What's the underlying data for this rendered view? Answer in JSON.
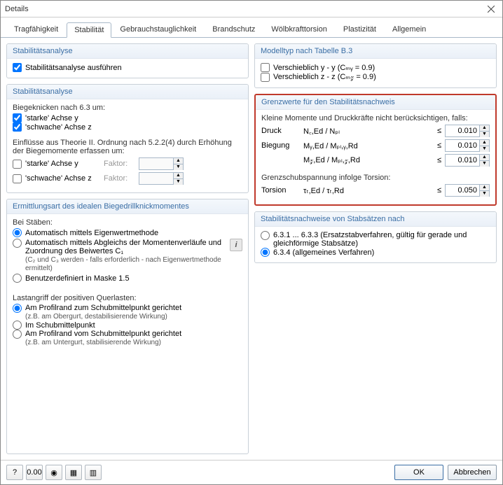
{
  "window": {
    "title": "Details"
  },
  "tabs": {
    "items": [
      {
        "label": "Tragfähigkeit"
      },
      {
        "label": "Stabilität"
      },
      {
        "label": "Gebrauchstauglichkeit"
      },
      {
        "label": "Brandschutz"
      },
      {
        "label": "Wölbkrafttorsion"
      },
      {
        "label": "Plastizität"
      },
      {
        "label": "Allgemein"
      }
    ],
    "active_index": 1
  },
  "left": {
    "analyse1": {
      "title": "Stabilitätsanalyse",
      "perform": {
        "label": "Stabilitätsanalyse ausführen",
        "checked": true
      }
    },
    "analyse2": {
      "title": "Stabilitätsanalyse",
      "bk_head": "Biegeknicken nach 6.3 um:",
      "starke_y": {
        "label": "'starke' Achse y",
        "checked": true
      },
      "schwache_z": {
        "label": "'schwache' Achse z",
        "checked": true
      },
      "einfluss_head": "Einflüsse aus Theorie II. Ordnung nach 5.2.2(4) durch Erhöhung der Biegemomente erfassen um:",
      "factor_label": "Faktor:",
      "starke_y2": {
        "label": "'starke' Achse y",
        "checked": false,
        "factor": ""
      },
      "schwache_z2": {
        "label": "'schwache' Achse z",
        "checked": false,
        "factor": ""
      }
    },
    "ermittlung": {
      "title": "Ermittlungsart des idealen Biegedrillknickmomentes",
      "bei_staeben": "Bei Stäben:",
      "r1": {
        "label": "Automatisch mittels Eigenwertmethode"
      },
      "r2": {
        "label": "Automatisch mittels Abgleichs der Momentenverläufe und Zuordnung des Beiwertes C₁",
        "note": "(C₂ und C₃ werden - falls erforderlich - nach Eigenwertmethode ermittelt)"
      },
      "r3": {
        "label": "Benutzerdefiniert in Maske 1.5"
      },
      "method_selected": "r1",
      "last_head": "Lastangriff der positiven Querlasten:",
      "l1": {
        "label": "Am Profilrand zum Schubmittelpunkt gerichtet",
        "note": "(z.B. am Obergurt, destabilisierende Wirkung)"
      },
      "l2": {
        "label": "Im Schubmittelpunkt"
      },
      "l3": {
        "label": "Am Profilrand vom Schubmittelpunkt gerichtet",
        "note": "(z.B. am Untergurt, stabilisierende Wirkung)"
      },
      "load_selected": "l1"
    }
  },
  "right": {
    "modelltyp": {
      "title": "Modelltyp nach Tabelle B.3",
      "vy": {
        "label": "Verschieblich y - y (Cₘᵧ = 0.9)",
        "checked": false
      },
      "vz": {
        "label": "Verschieblich z - z (Cₘ𝓏 = 0.9)",
        "checked": false
      }
    },
    "grenzwerte": {
      "title": "Grenzwerte für den Stabilitätsnachweis",
      "head": "Kleine Momente und Druckkräfte nicht berücksichtigen, falls:",
      "rows": [
        {
          "name": "Druck",
          "expr": "N꜀,Ed / Nₚₗ",
          "op": "≤",
          "val": "0.010"
        },
        {
          "name": "Biegung",
          "expr": "Mᵧ,Ed / Mₚₗ,ᵧ,Rd",
          "op": "≤",
          "val": "0.010"
        },
        {
          "name": "",
          "expr": "M𝓏,Ed / Mₚₗ,𝓏,Rd",
          "op": "≤",
          "val": "0.010"
        }
      ],
      "shear_head": "Grenzschubspannung infolge Torsion:",
      "torsion": {
        "name": "Torsion",
        "expr": "τₜ,Ed / τₜ,Rd",
        "op": "≤",
        "val": "0.050"
      }
    },
    "stabsaetze": {
      "title": "Stabilitätsnachweise von Stabsätzen nach",
      "r1": {
        "label": "6.3.1 ... 6.3.3  (Ersatzstabverfahren, gültig für gerade und gleichförmige Stabsätze)"
      },
      "r2": {
        "label": "6.3.4 (allgemeines Verfahren)"
      },
      "selected": "r2"
    }
  },
  "footer": {
    "ok": "OK",
    "cancel": "Abbrechen",
    "icons": [
      "?",
      "0.00",
      "◉",
      "▦",
      "▥"
    ]
  }
}
